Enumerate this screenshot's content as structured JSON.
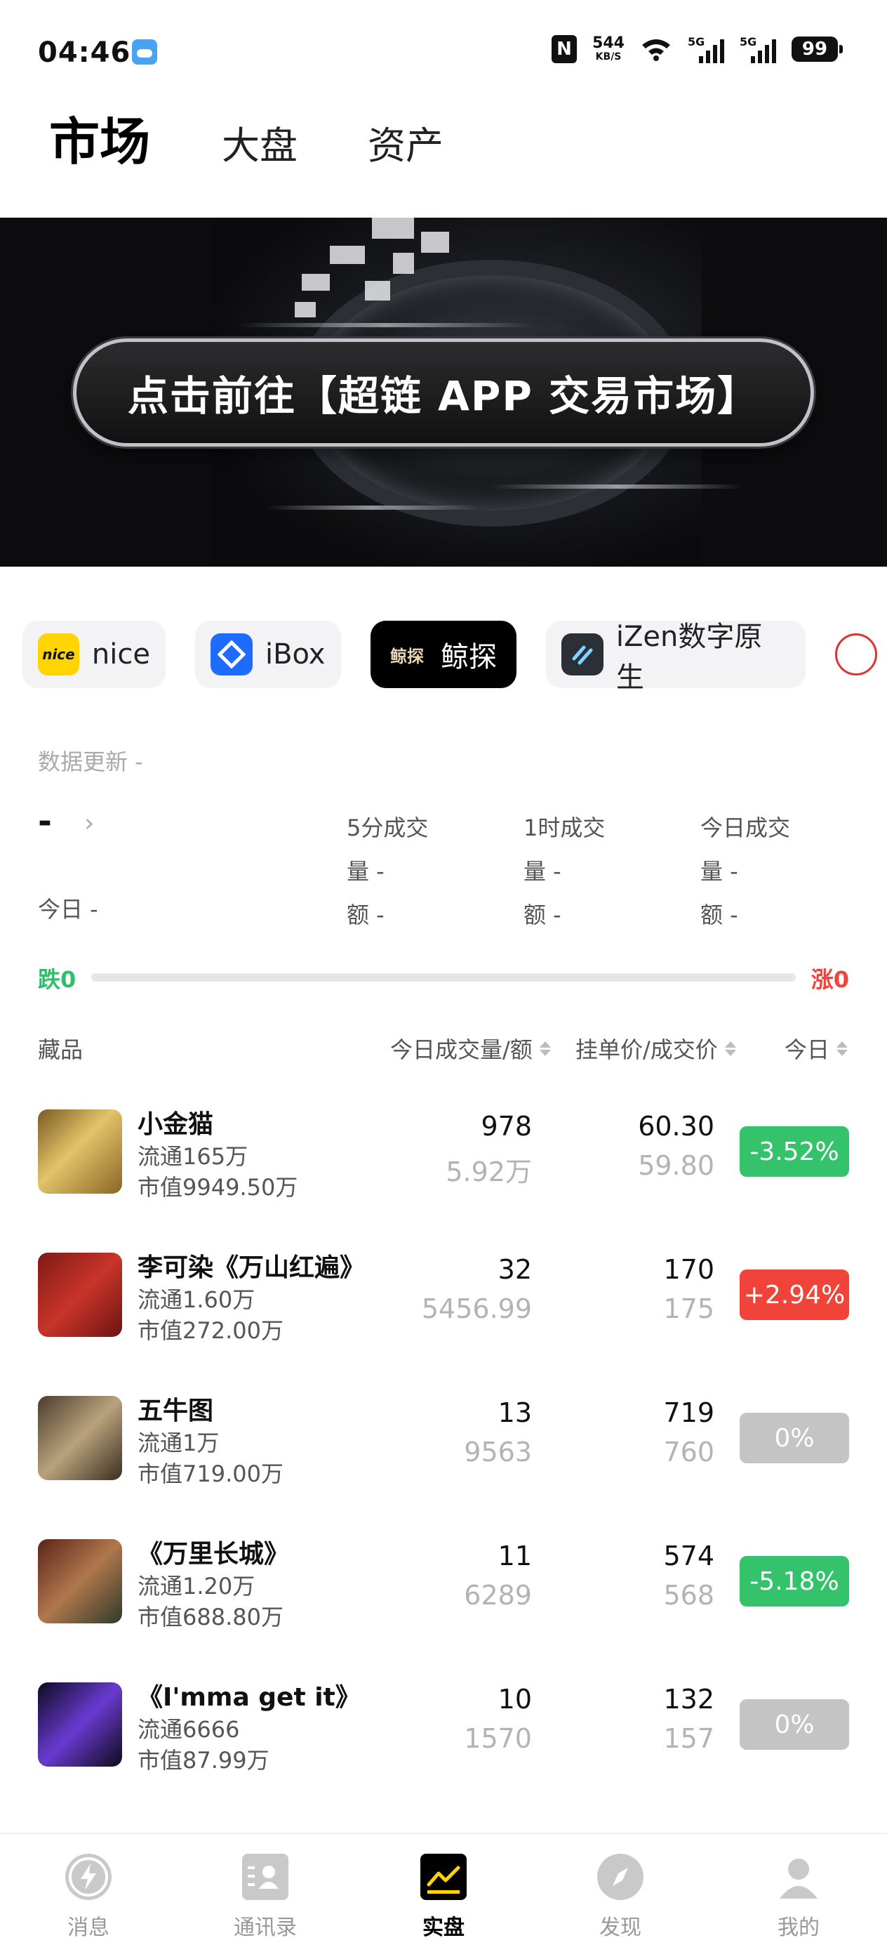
{
  "status_bar": {
    "time": "04:46",
    "speed_value": "544",
    "speed_unit": "KB/S",
    "net1": "5G",
    "net2": "5G",
    "battery": "99"
  },
  "header": {
    "tabs": [
      {
        "label": "市场",
        "active": true
      },
      {
        "label": "大盘",
        "active": false
      },
      {
        "label": "资产",
        "active": false
      }
    ]
  },
  "banner": {
    "text": "点击前往【超链 APP 交易市场】"
  },
  "platforms": [
    {
      "label": "nice",
      "icon": "nice-logo-icon",
      "icon_text": "nice",
      "icon_bg": "#ffd400",
      "active": false
    },
    {
      "label": "iBox",
      "icon": "ibox-logo-icon",
      "icon_text": "",
      "icon_bg": "#1e6bff",
      "active": false
    },
    {
      "label": "鲸探",
      "icon": "jingtan-logo-icon",
      "icon_text": "鲸探",
      "icon_bg": "#111111",
      "active": true
    },
    {
      "label": "iZen数字原生",
      "icon": "izen-logo-icon",
      "icon_text": "",
      "icon_bg": "#2b2f36",
      "active": false
    }
  ],
  "stats": {
    "update_label": "数据更新 -",
    "main_value": "-",
    "today": "今日 -",
    "col5m": {
      "title": "5分成交",
      "vol": "量 -",
      "amt": "额 -"
    },
    "col1h": {
      "title": "1时成交",
      "vol": "量 -",
      "amt": "额 -"
    },
    "colday": {
      "title": "今日成交",
      "vol": "量 -",
      "amt": "额 -"
    },
    "fall": "跌0",
    "rise": "涨0"
  },
  "table": {
    "headers": {
      "item": "藏品",
      "volume": "今日成交量/额",
      "price": "挂单价/成交价",
      "change": "今日"
    },
    "rows": [
      {
        "name": "小金猫",
        "circulation": "流通165万",
        "market_cap": "市值9949.50万",
        "vol": "978",
        "amount": "5.92万",
        "list_price": "60.30",
        "deal_price": "59.80",
        "change": "-3.52%",
        "trend": "down"
      },
      {
        "name": "李可染《万山红遍》",
        "circulation": "流通1.60万",
        "market_cap": "市值272.00万",
        "vol": "32",
        "amount": "5456.99",
        "list_price": "170",
        "deal_price": "175",
        "change": "+2.94%",
        "trend": "up"
      },
      {
        "name": "五牛图",
        "circulation": "流通1万",
        "market_cap": "市值719.00万",
        "vol": "13",
        "amount": "9563",
        "list_price": "719",
        "deal_price": "760",
        "change": "0%",
        "trend": "flat"
      },
      {
        "name": "《万里长城》",
        "circulation": "流通1.20万",
        "market_cap": "市值688.80万",
        "vol": "11",
        "amount": "6289",
        "list_price": "574",
        "deal_price": "568",
        "change": "-5.18%",
        "trend": "down"
      },
      {
        "name": "《I'mma get it》",
        "circulation": "流通6666",
        "market_cap": "市值87.99万",
        "vol": "10",
        "amount": "1570",
        "list_price": "132",
        "deal_price": "157",
        "change": "0%",
        "trend": "flat"
      }
    ]
  },
  "colors": {
    "up": "#f0443a",
    "down": "#34c26a",
    "flat": "#c4c4c4"
  },
  "bottom_nav": [
    {
      "label": "消息",
      "icon": "lightning-icon",
      "active": false
    },
    {
      "label": "通讯录",
      "icon": "contacts-icon",
      "active": false
    },
    {
      "label": "实盘",
      "icon": "chart-icon",
      "active": true
    },
    {
      "label": "发现",
      "icon": "compass-icon",
      "active": false
    },
    {
      "label": "我的",
      "icon": "user-icon",
      "active": false
    }
  ]
}
